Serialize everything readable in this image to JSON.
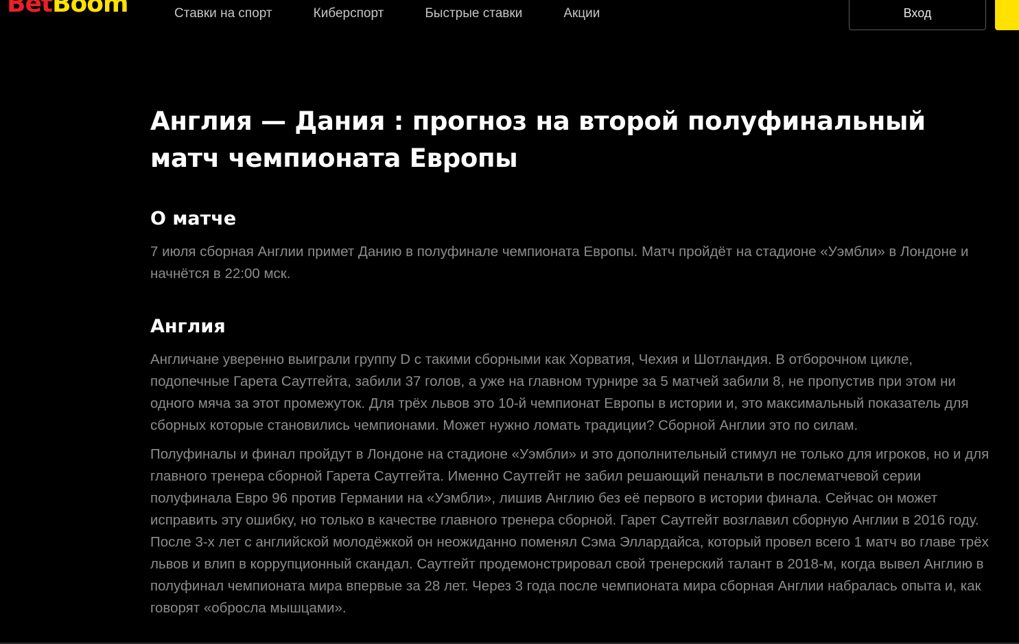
{
  "header": {
    "logo_part1": "Bet",
    "logo_part2": "Boom",
    "nav": [
      {
        "label": "Ставки на спорт"
      },
      {
        "label": "Киберспорт"
      },
      {
        "label": "Быстрые ставки"
      },
      {
        "label": "Акции"
      }
    ],
    "login_label": "Вход"
  },
  "article": {
    "title": "Англия — Дания : прогноз на второй полуфинальный матч чемпионата Европы",
    "sections": [
      {
        "heading": "О матче",
        "paragraphs": [
          "7 июля сборная Англии примет Данию в полуфинале чемпионата Европы. Матч пройдёт на стадионе «Уэмбли» в Лондоне и начнётся в 22:00 мск."
        ]
      },
      {
        "heading": "Англия",
        "paragraphs": [
          "Англичане уверенно выиграли группу D с такими сборными как Хорватия, Чехия и Шотландия. В отборочном цикле, подопечные Гарета Саутгейта, забили 37 голов, а уже на главном турнире за 5 матчей забили 8, не пропустив при этом ни одного мяча за этот промежуток. Для трёх львов это 10-й чемпионат Европы в истории и, это максимальный показатель для сборных которые становились чемпионами. Может нужно ломать традиции? Сборной Англии это по силам.",
          "Полуфиналы и финал пройдут в Лондоне на стадионе «Уэмбли» и это дополнительный стимул не только для игроков, но и для главного тренера сборной Гарета Саутгейта. Именно Саутгейт не забил решающий пенальти в послематчевой серии полуфинала Евро 96 против Германии на «Уэмбли», лишив Англию без её первого в истории финала. Сейчас он может исправить эту ошибку, но только в качестве главного тренера сборной. Гарет Саутгейт возглавил сборную Англии в 2016 году. После 3-х лет с английской молодёжкой он неожиданно поменял Сэма Эллардайса, который провел всего 1 матч во главе трёх львов и влип в коррупционный скандал. Саутгейт продемонстрировал свой тренерский талант в 2018-м, когда вывел Англию в полуфинал чемпионата мира впервые за 28 лет. Через 3 года после чемпионата мира сборная Англии набралась опыта и, как говорят «обросла мышцами»."
        ]
      }
    ]
  },
  "colors": {
    "background": "#000000",
    "logo_red": "#e8202a",
    "logo_yellow": "#ffe200",
    "heading": "#ffffff",
    "body_text": "#8c8c8c",
    "nav_text": "#c6c6c6"
  }
}
